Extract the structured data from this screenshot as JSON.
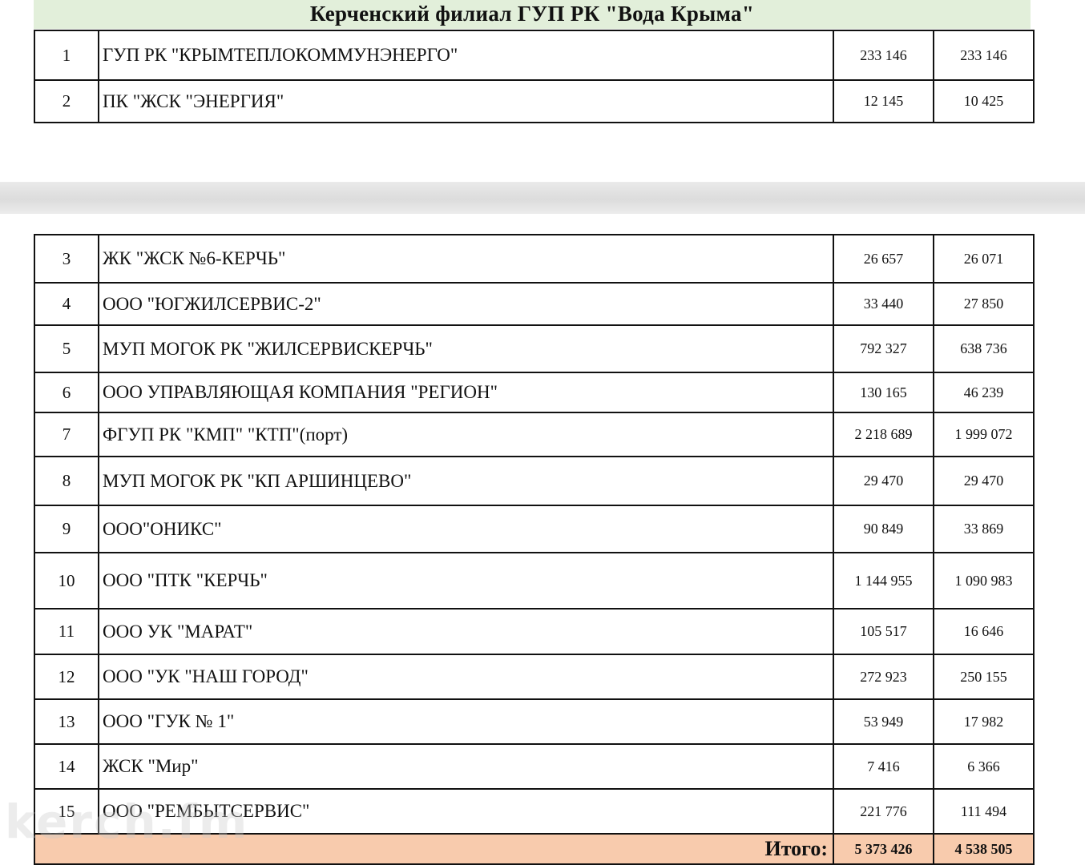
{
  "title": "Керченский  филиал ГУП РК \"Вода Крыма\"",
  "rows_top": [
    {
      "n": "1",
      "name": "ГУП РК \"КРЫМТЕПЛОКОММУНЭНЕРГО\"",
      "v1": "233 146",
      "v2": "233 146"
    },
    {
      "n": "2",
      "name": "ПК \"ЖСК \"ЭНЕРГИЯ\"",
      "v1": "12 145",
      "v2": "10 425"
    }
  ],
  "rows_bottom": [
    {
      "n": "3",
      "name": "ЖК \"ЖСК №6-КЕРЧЬ\"",
      "v1": "26 657",
      "v2": "26 071"
    },
    {
      "n": "4",
      "name": "ООО \"ЮГЖИЛСЕРВИС-2\"",
      "v1": "33 440",
      "v2": "27 850"
    },
    {
      "n": "5",
      "name": "МУП МОГОК РК \"ЖИЛСЕРВИСКЕРЧЬ\"",
      "v1": "792 327",
      "v2": "638 736"
    },
    {
      "n": "6",
      "name": "ООО УПРАВЛЯЮЩАЯ КОМПАНИЯ \"РЕГИОН\"",
      "v1": "130 165",
      "v2": "46 239"
    },
    {
      "n": "7",
      "name": "ФГУП РК \"КМП\" \"КТП\"(порт)",
      "v1": "2 218 689",
      "v2": "1 999 072"
    },
    {
      "n": "8",
      "name": "МУП МОГОК РК \"КП АРШИНЦЕВО\"",
      "v1": "29 470",
      "v2": "29 470"
    },
    {
      "n": "9",
      "name": "ООО\"ОНИКС\"",
      "v1": "90 849",
      "v2": "33 869"
    },
    {
      "n": "10",
      "name": "ООО \"ПТК \"КЕРЧЬ\"",
      "v1": "1 144 955",
      "v2": "1 090 983"
    },
    {
      "n": "11",
      "name": "ООО  УК \"МАРАТ\"",
      "v1": "105 517",
      "v2": "16 646"
    },
    {
      "n": "12",
      "name": "ООО \"УК \"НАШ ГОРОД\"",
      "v1": "272 923",
      "v2": "250 155"
    },
    {
      "n": "13",
      "name": "ООО \"ГУК № 1\"",
      "v1": "53 949",
      "v2": "17 982"
    },
    {
      "n": "14",
      "name": "ЖСК \"Мир\"",
      "v1": "7 416",
      "v2": "6 366"
    },
    {
      "n": "15",
      "name": "ООО \"РЕМБЫТСЕРВИС\"",
      "v1": "221 776",
      "v2": "111 494"
    }
  ],
  "total": {
    "label": "Итого:",
    "v1": "5 373 426",
    "v2": "4 538 505"
  },
  "watermark": "kerch.fm",
  "colors": {
    "title_bg": "#e2efda",
    "total_bg": "#f8cbad",
    "separator": "#dcdcdc"
  }
}
